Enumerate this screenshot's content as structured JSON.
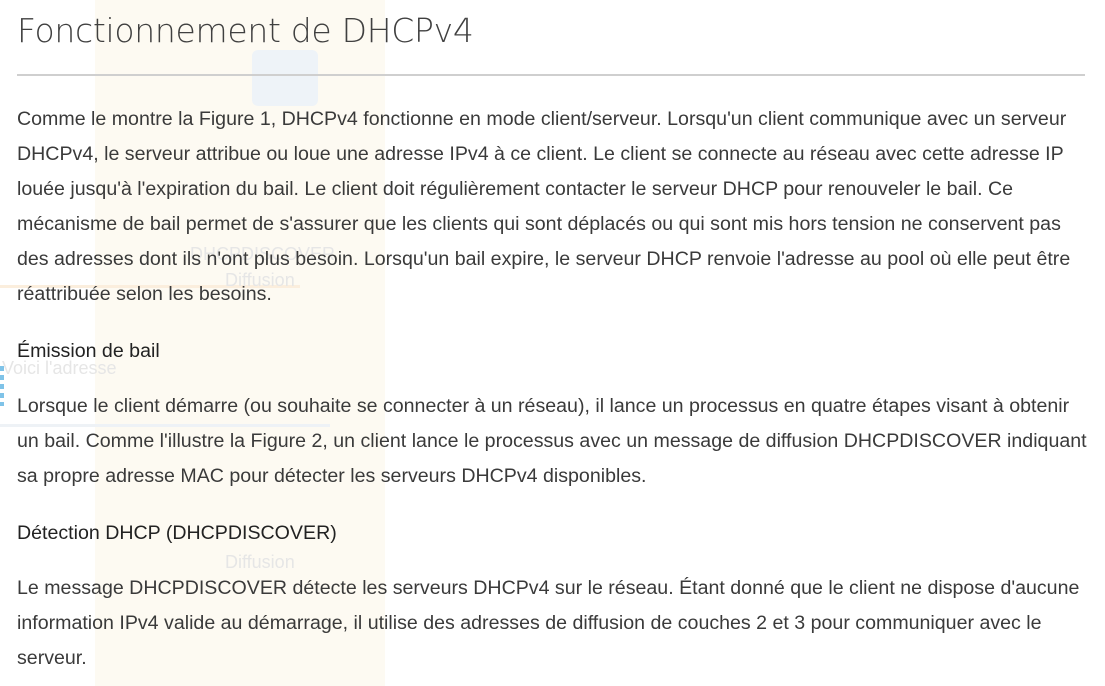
{
  "page": {
    "title": "Fonctionnement de DHCPv4"
  },
  "sections": [
    {
      "type": "paragraph",
      "text": "Comme le montre la Figure 1, DHCPv4 fonctionne en mode client/serveur. Lorsqu'un client communique avec un serveur DHCPv4, le serveur attribue ou loue une adresse IPv4 à ce client. Le client se connecte au réseau avec cette adresse IP louée jusqu'à l'expiration du bail. Le client doit régulièrement contacter le serveur DHCP pour renouveler le bail. Ce mécanisme de bail permet de s'assurer que les clients qui sont déplacés ou qui sont mis hors tension ne conservent pas des adresses dont ils n'ont plus besoin. Lorsqu'un bail expire, le serveur DHCP renvoie l'adresse au pool où elle peut être réattribuée selon les besoins."
    },
    {
      "type": "heading",
      "text": "Émission de bail"
    },
    {
      "type": "paragraph",
      "text": "Lorsque le client démarre (ou souhaite se connecter à un réseau), il lance un processus en quatre étapes visant à obtenir un bail. Comme l'illustre la Figure 2, un client lance le processus avec un message de diffusion DHCPDISCOVER indiquant sa propre adresse MAC pour détecter les serveurs DHCPv4 disponibles."
    },
    {
      "type": "heading",
      "text": "Détection DHCP (DHCPDISCOVER)"
    },
    {
      "type": "paragraph",
      "text": "Le message DHCPDISCOVER détecte les serveurs DHCPv4 sur le réseau. Étant donné que le client ne dispose d'aucune information IPv4 valide au démarrage, il utilise des adresses de diffusion de couches 2 et 3 pour communiquer avec le serveur."
    }
  ],
  "background_figure_text": {
    "discover": "DHCPDISCOVER",
    "offer_text": "Voici l'adresse",
    "broadcast_1": "Diffusion",
    "broadcast_2": "Diffusion"
  }
}
